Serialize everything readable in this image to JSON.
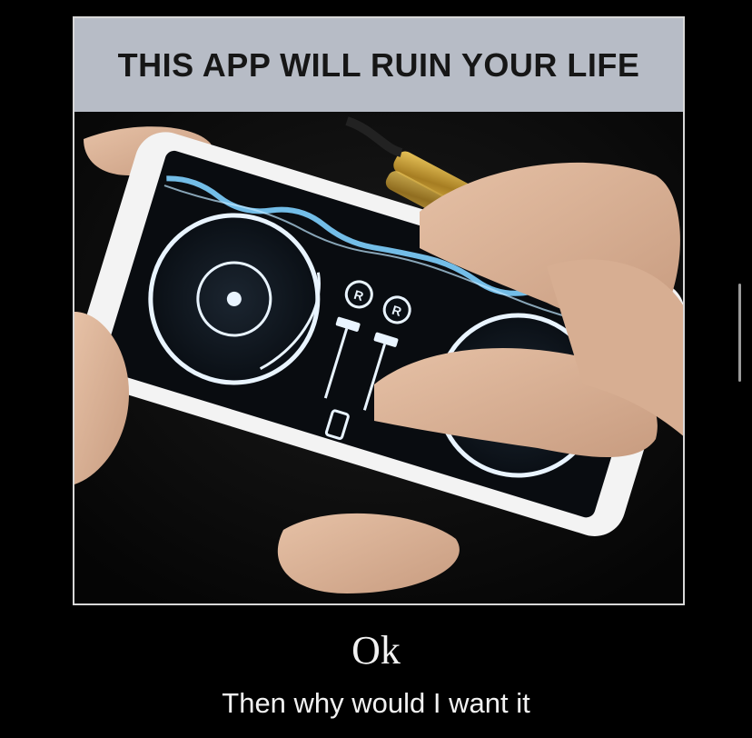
{
  "meme": {
    "header_text": "THIS APP WILL RUIN YOUR LIFE",
    "caption_big": "Ok",
    "caption_small": "Then why would I want it"
  },
  "photo": {
    "subject": "hands-using-dj-app-on-phone",
    "deck_labels": [
      "R",
      "R"
    ],
    "colors": {
      "accent": "#7fd0ff",
      "banner": "#b7bcc6",
      "background": "#000000"
    }
  }
}
